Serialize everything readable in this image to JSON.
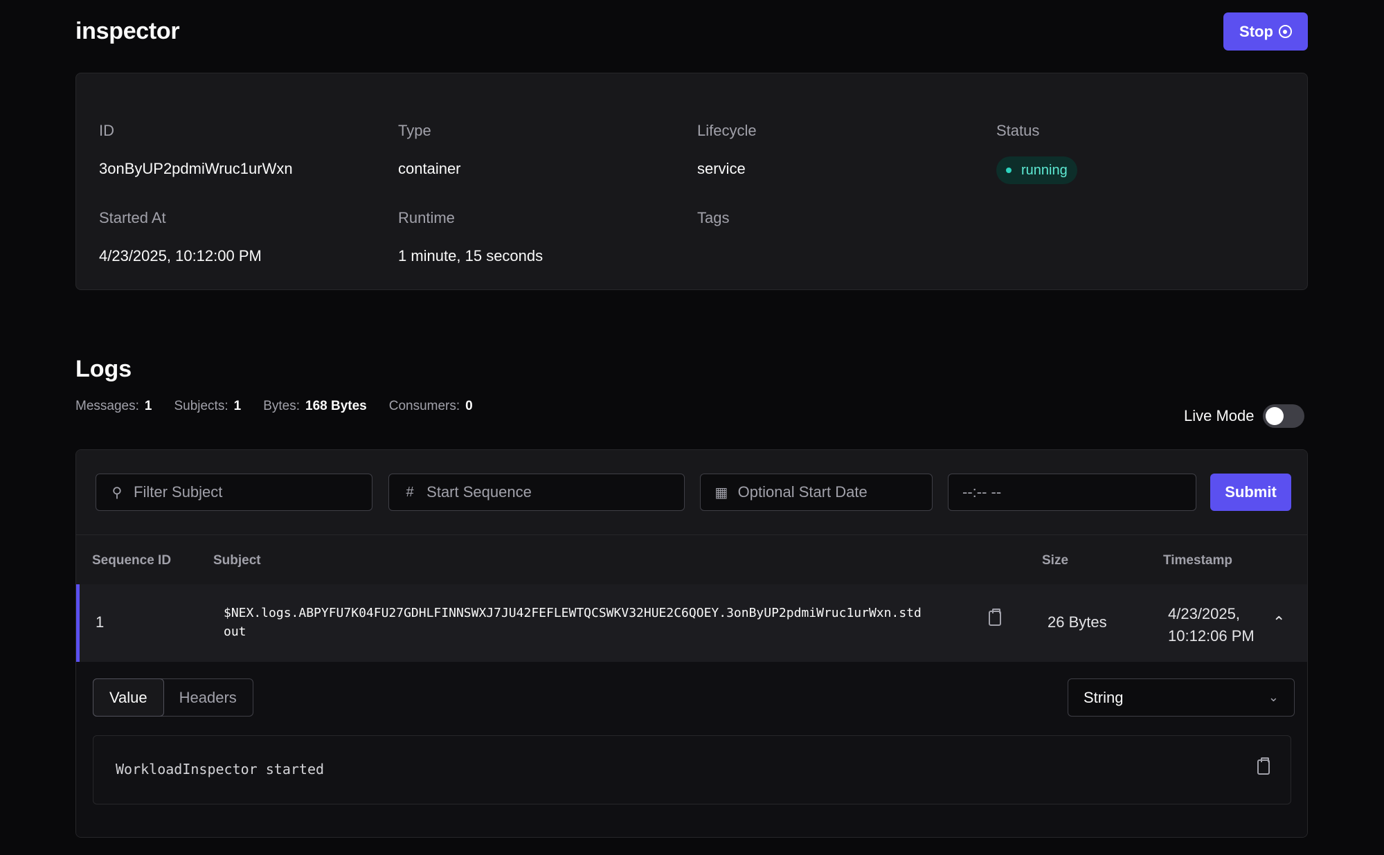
{
  "header": {
    "title": "inspector",
    "stop_label": "Stop"
  },
  "info": {
    "id_label": "ID",
    "id_value": "3onByUP2pdmiWruc1urWxn",
    "type_label": "Type",
    "type_value": "container",
    "lifecycle_label": "Lifecycle",
    "lifecycle_value": "service",
    "status_label": "Status",
    "status_value": "running",
    "started_label": "Started At",
    "started_value": "4/23/2025, 10:12:00 PM",
    "runtime_label": "Runtime",
    "runtime_value": "1 minute, 15 seconds",
    "tags_label": "Tags"
  },
  "logs": {
    "title": "Logs",
    "stats": {
      "messages_label": "Messages:",
      "messages_value": "1",
      "subjects_label": "Subjects:",
      "subjects_value": "1",
      "bytes_label": "Bytes:",
      "bytes_value": "168 Bytes",
      "consumers_label": "Consumers:",
      "consumers_value": "0"
    },
    "live_mode_label": "Live Mode",
    "live_mode_on": false,
    "filters": {
      "subject_placeholder": "Filter Subject",
      "sequence_placeholder": "Start Sequence",
      "date_placeholder": "Optional Start Date",
      "time_value": "--:-- --",
      "submit_label": "Submit"
    },
    "columns": {
      "sequence": "Sequence ID",
      "subject": "Subject",
      "size": "Size",
      "timestamp": "Timestamp"
    },
    "rows": [
      {
        "sequence": "1",
        "subject_line1": "$NEX.logs.ABPYFU7K04FU27GDHLFINNSWXJ7JU42FEFLEWTQCSWKV32HUE2C6QOEY.3onByUP2pdmiWruc1urWxn.std",
        "subject_line2": "out",
        "size": "26 Bytes",
        "timestamp_line1": "4/23/2025,",
        "timestamp_line2": "10:12:06 PM"
      }
    ],
    "detail": {
      "tabs": [
        "Value",
        "Headers"
      ],
      "active_tab": "Value",
      "format": "String",
      "value": "WorkloadInspector started"
    }
  },
  "colors": {
    "accent": "#5b50f0",
    "background": "#09090b",
    "status_running": "#5eead4"
  }
}
